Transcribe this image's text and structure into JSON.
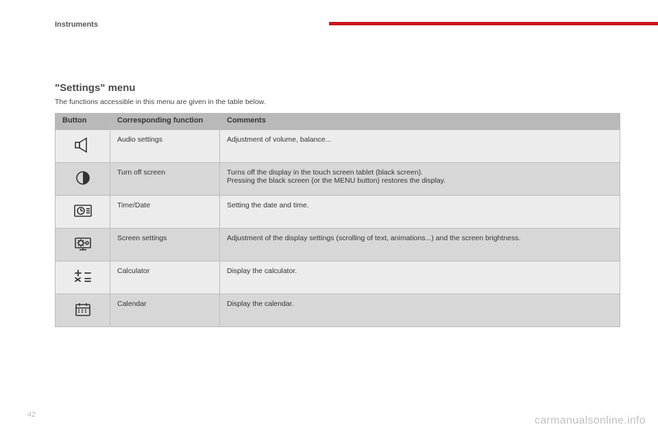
{
  "section_label": "Instruments",
  "title": "\"Settings\" menu",
  "subtitle": "The functions accessible in this menu are given in the table below.",
  "table": {
    "headers": {
      "button": "Button",
      "function": "Corresponding function",
      "comments": "Comments"
    },
    "rows": [
      {
        "icon": "speaker-icon",
        "function": "Audio settings",
        "comments": "Adjustment of volume, balance..."
      },
      {
        "icon": "contrast-icon",
        "function": "Turn off screen",
        "comments": "Turns off the display in the touch screen tablet (black screen).\nPressing the black screen (or the MENU button) restores the display."
      },
      {
        "icon": "clock-box-icon",
        "function": "Time/Date",
        "comments": "Setting the date and time."
      },
      {
        "icon": "screen-settings-icon",
        "function": "Screen settings",
        "comments": "Adjustment of the display settings (scrolling of text, animations...) and the screen brightness."
      },
      {
        "icon": "calculator-icon",
        "function": "Calculator",
        "comments": "Display the calculator."
      },
      {
        "icon": "calendar-icon",
        "function": "Calendar",
        "comments": "Display the calendar."
      }
    ]
  },
  "page_number": "42",
  "watermark": "carmanualsonline.info"
}
